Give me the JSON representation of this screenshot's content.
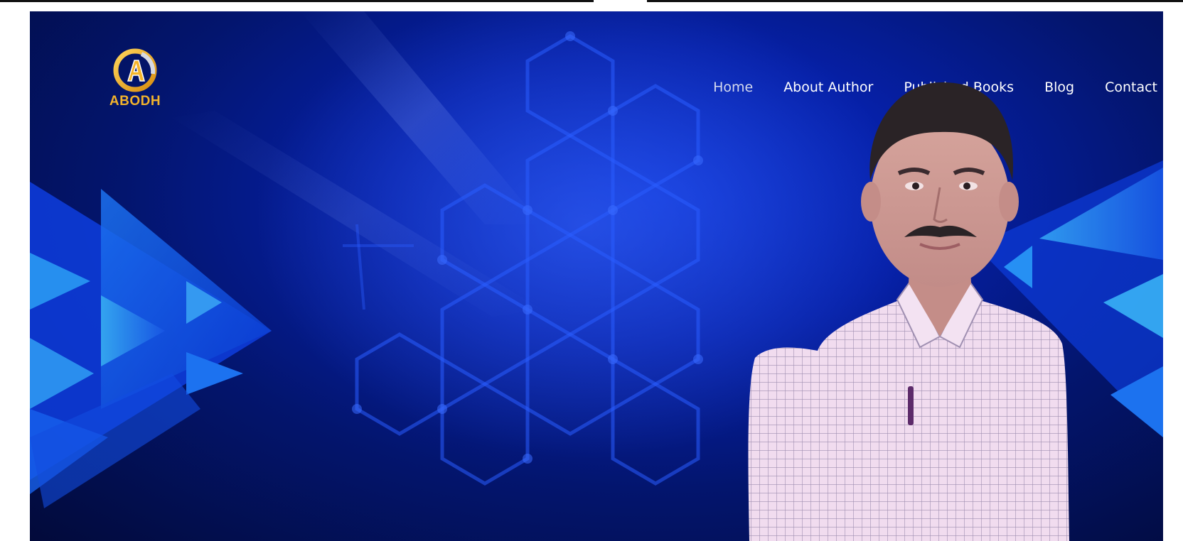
{
  "logo": {
    "letter": "A",
    "wordmark": "ABODH",
    "gold": "#f2b32c",
    "silver": "#c9ccd6"
  },
  "nav": {
    "items": [
      {
        "label": "Home",
        "active": true
      },
      {
        "label": "About Author",
        "active": false
      },
      {
        "label": "Published Books",
        "active": false
      },
      {
        "label": "Blog",
        "active": false
      },
      {
        "label": "Contact",
        "active": false
      }
    ]
  },
  "hero": {
    "background_colors": [
      "#020a3a",
      "#03156e",
      "#0620a8",
      "#0a2fd0",
      "#1e6cff",
      "#39b4ff"
    ],
    "portrait": "man-in-checked-shirt-portrait"
  }
}
